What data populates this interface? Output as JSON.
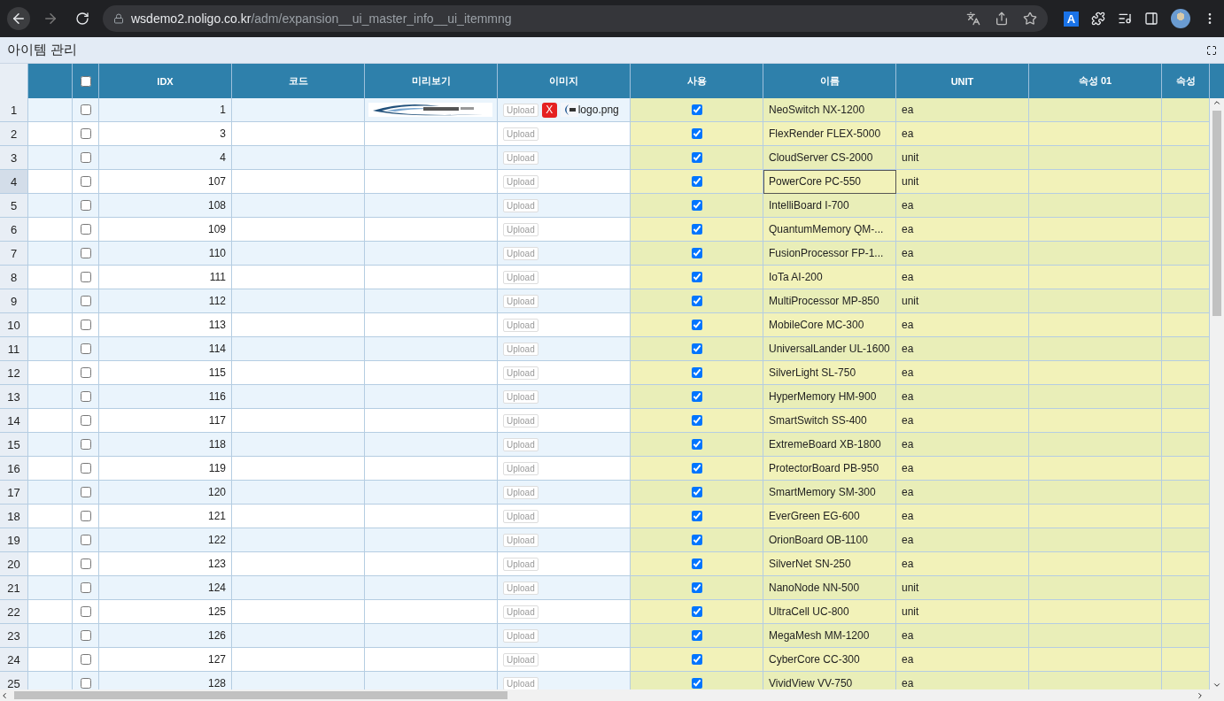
{
  "browser": {
    "url_host": "wsdemo2.noligo.co.kr",
    "url_path": "/adm/expansion__ui_master_info__ui_itemmng",
    "extension_badge": "A"
  },
  "page": {
    "title": "아이템 관리"
  },
  "table": {
    "columns": [
      "IDX",
      "코드",
      "미리보기",
      "이미지",
      "사용",
      "이름",
      "UNIT",
      "속성 01",
      "속성"
    ],
    "header_checked": false,
    "rows": [
      {
        "num": "1",
        "checked": false,
        "idx": "1",
        "upload": "Upload",
        "file": {
          "remove": "X",
          "filename": "logo.png"
        },
        "used": true,
        "name": "NeoSwitch NX-1200",
        "unit": "ea",
        "selected": false
      },
      {
        "num": "2",
        "checked": false,
        "idx": "3",
        "upload": "Upload",
        "used": true,
        "name": "FlexRender FLEX-5000",
        "unit": "ea",
        "selected": false
      },
      {
        "num": "3",
        "checked": false,
        "idx": "4",
        "upload": "Upload",
        "used": true,
        "name": "CloudServer CS-2000",
        "unit": "unit",
        "selected": false
      },
      {
        "num": "4",
        "checked": false,
        "idx": "107",
        "upload": "Upload",
        "used": true,
        "name": "PowerCore PC-550",
        "unit": "unit",
        "selected": true
      },
      {
        "num": "5",
        "checked": false,
        "idx": "108",
        "upload": "Upload",
        "used": true,
        "name": "IntelliBoard I-700",
        "unit": "ea",
        "selected": false
      },
      {
        "num": "6",
        "checked": false,
        "idx": "109",
        "upload": "Upload",
        "used": true,
        "name": "QuantumMemory QM-...",
        "unit": "ea",
        "selected": false
      },
      {
        "num": "7",
        "checked": false,
        "idx": "110",
        "upload": "Upload",
        "used": true,
        "name": "FusionProcessor FP-1...",
        "unit": "ea",
        "selected": false
      },
      {
        "num": "8",
        "checked": false,
        "idx": "111",
        "upload": "Upload",
        "used": true,
        "name": "IoTa AI-200",
        "unit": "ea",
        "selected": false
      },
      {
        "num": "9",
        "checked": false,
        "idx": "112",
        "upload": "Upload",
        "used": true,
        "name": "MultiProcessor MP-850",
        "unit": "unit",
        "selected": false
      },
      {
        "num": "10",
        "checked": false,
        "idx": "113",
        "upload": "Upload",
        "used": true,
        "name": "MobileCore MC-300",
        "unit": "ea",
        "selected": false
      },
      {
        "num": "11",
        "checked": false,
        "idx": "114",
        "upload": "Upload",
        "used": true,
        "name": "UniversalLander UL-1600",
        "unit": "ea",
        "selected": false
      },
      {
        "num": "12",
        "checked": false,
        "idx": "115",
        "upload": "Upload",
        "used": true,
        "name": "SilverLight SL-750",
        "unit": "ea",
        "selected": false
      },
      {
        "num": "13",
        "checked": false,
        "idx": "116",
        "upload": "Upload",
        "used": true,
        "name": "HyperMemory HM-900",
        "unit": "ea",
        "selected": false
      },
      {
        "num": "14",
        "checked": false,
        "idx": "117",
        "upload": "Upload",
        "used": true,
        "name": "SmartSwitch SS-400",
        "unit": "ea",
        "selected": false
      },
      {
        "num": "15",
        "checked": false,
        "idx": "118",
        "upload": "Upload",
        "used": true,
        "name": "ExtremeBoard XB-1800",
        "unit": "ea",
        "selected": false
      },
      {
        "num": "16",
        "checked": false,
        "idx": "119",
        "upload": "Upload",
        "used": true,
        "name": "ProtectorBoard PB-950",
        "unit": "ea",
        "selected": false
      },
      {
        "num": "17",
        "checked": false,
        "idx": "120",
        "upload": "Upload",
        "used": true,
        "name": "SmartMemory SM-300",
        "unit": "ea",
        "selected": false
      },
      {
        "num": "18",
        "checked": false,
        "idx": "121",
        "upload": "Upload",
        "used": true,
        "name": "EverGreen EG-600",
        "unit": "ea",
        "selected": false
      },
      {
        "num": "19",
        "checked": false,
        "idx": "122",
        "upload": "Upload",
        "used": true,
        "name": "OrionBoard OB-1100",
        "unit": "ea",
        "selected": false
      },
      {
        "num": "20",
        "checked": false,
        "idx": "123",
        "upload": "Upload",
        "used": true,
        "name": "SilverNet SN-250",
        "unit": "ea",
        "selected": false
      },
      {
        "num": "21",
        "checked": false,
        "idx": "124",
        "upload": "Upload",
        "used": true,
        "name": "NanoNode NN-500",
        "unit": "unit",
        "selected": false
      },
      {
        "num": "22",
        "checked": false,
        "idx": "125",
        "upload": "Upload",
        "used": true,
        "name": "UltraCell UC-800",
        "unit": "unit",
        "selected": false
      },
      {
        "num": "23",
        "checked": false,
        "idx": "126",
        "upload": "Upload",
        "used": true,
        "name": "MegaMesh MM-1200",
        "unit": "ea",
        "selected": false
      },
      {
        "num": "24",
        "checked": false,
        "idx": "127",
        "upload": "Upload",
        "used": true,
        "name": "CyberCore CC-300",
        "unit": "ea",
        "selected": false
      },
      {
        "num": "25",
        "checked": false,
        "idx": "128",
        "upload": "Upload",
        "used": true,
        "name": "VividView VV-750",
        "unit": "ea",
        "selected": false
      }
    ]
  }
}
